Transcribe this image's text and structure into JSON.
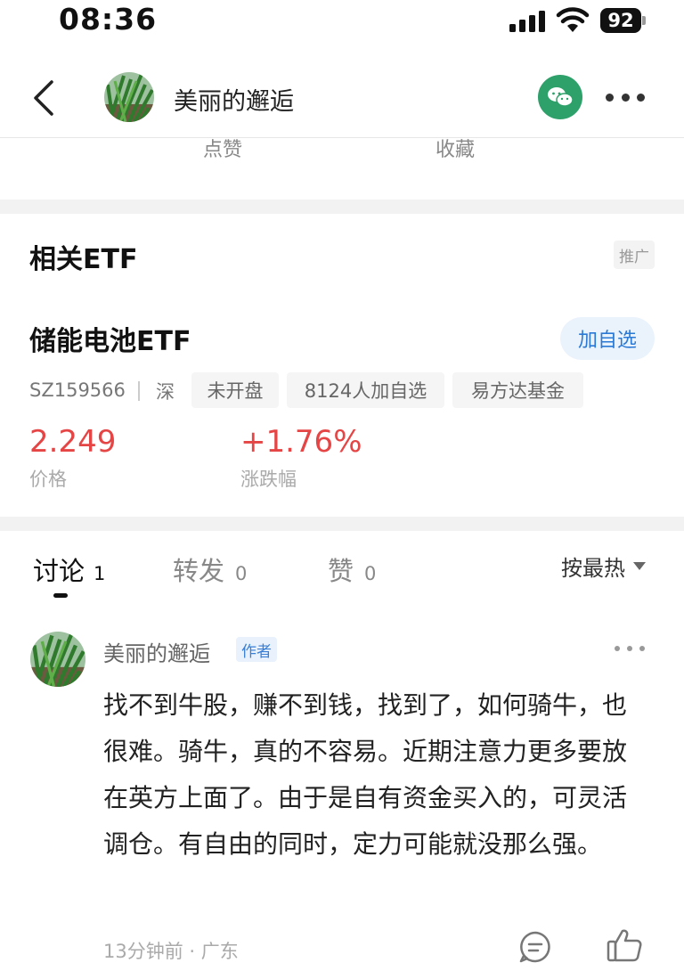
{
  "status_bar": {
    "time": "08:36",
    "battery": "92"
  },
  "nav": {
    "title": "美丽的邂逅"
  },
  "actions": {
    "like_label": "点赞",
    "favorite_label": "收藏"
  },
  "etf_section": {
    "heading": "相关ETF",
    "promo_badge": "推广",
    "name": "储能电池ETF",
    "watch_button": "加自选",
    "code": "SZ159566",
    "market": "深",
    "tags": [
      "未开盘",
      "8124人加自选",
      "易方达基金"
    ],
    "price": {
      "value": "2.249",
      "label": "价格"
    },
    "change": {
      "value": "+1.76%",
      "label": "涨跌幅"
    },
    "accent_color": "#e54545"
  },
  "tabs": [
    {
      "label": "讨论",
      "count": "1"
    },
    {
      "label": "转发",
      "count": "0"
    },
    {
      "label": "赞",
      "count": "0"
    }
  ],
  "sort": {
    "label": "按最热"
  },
  "comment": {
    "author": "美丽的邂逅",
    "author_badge": "作者",
    "body": "找不到牛股，赚不到钱，找到了，如何骑牛，也很难。骑牛，真的不容易。近期注意力更多要放在英方上面了。由于是自有资金买入的，可灵活调仓。有自由的同时，定力可能就没那么强。",
    "meta": "13分钟前 · 广东"
  },
  "icons": {
    "back": "back-arrow-icon",
    "wechat": "wechat-icon",
    "more": "more-icon",
    "reply": "reply-icon",
    "like": "thumbs-up-icon"
  }
}
